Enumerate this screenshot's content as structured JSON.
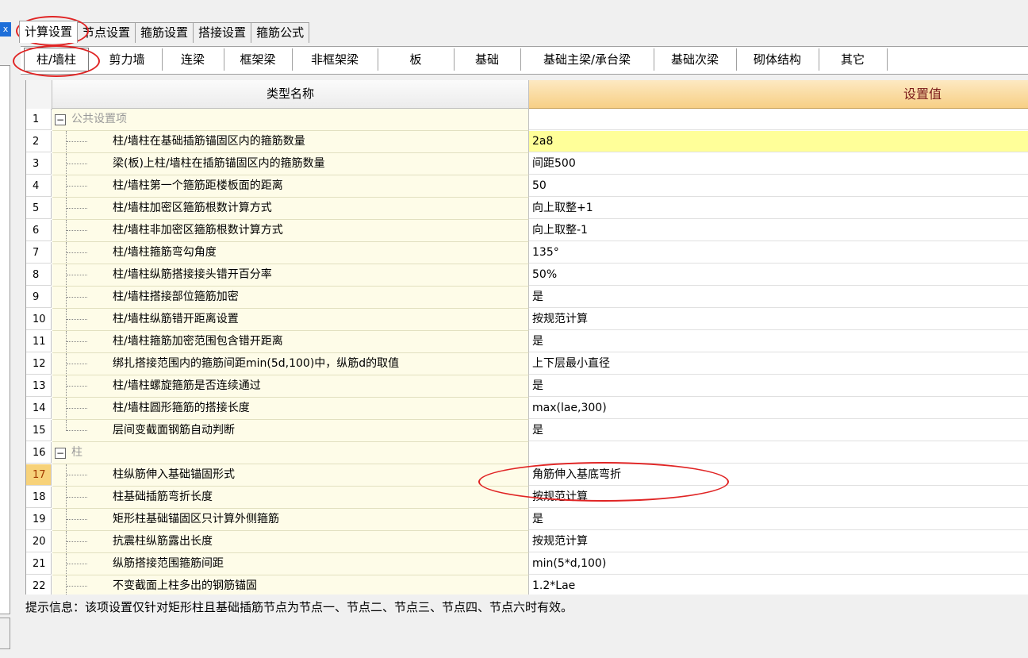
{
  "close_glyph": "x",
  "main_tabs": [
    {
      "label": "计算设置",
      "active": true
    },
    {
      "label": "节点设置",
      "active": false
    },
    {
      "label": "箍筋设置",
      "active": false
    },
    {
      "label": "搭接设置",
      "active": false
    },
    {
      "label": "箍筋公式",
      "active": false
    }
  ],
  "sub_tabs": [
    {
      "label": "柱/墙柱",
      "active": true
    },
    {
      "label": "剪力墙"
    },
    {
      "label": "连梁"
    },
    {
      "label": "框架梁"
    },
    {
      "label": "非框架梁"
    },
    {
      "label": "板"
    },
    {
      "label": "基础"
    },
    {
      "label": "基础主梁/承台梁"
    },
    {
      "label": "基础次梁"
    },
    {
      "label": "砌体结构"
    },
    {
      "label": "其它"
    }
  ],
  "grid": {
    "header_name": "类型名称",
    "header_value": "设置值",
    "rows": [
      {
        "num": "1",
        "type": "group",
        "label": "公共设置项",
        "value": ""
      },
      {
        "num": "2",
        "type": "item",
        "label": "柱/墙柱在基础插筋锚固区内的箍筋数量",
        "value": "2a8",
        "highlight": true
      },
      {
        "num": "3",
        "type": "item",
        "label": "梁(板)上柱/墙柱在插筋锚固区内的箍筋数量",
        "value": "间距500"
      },
      {
        "num": "4",
        "type": "item",
        "label": "柱/墙柱第一个箍筋距楼板面的距离",
        "value": "50"
      },
      {
        "num": "5",
        "type": "item",
        "label": "柱/墙柱加密区箍筋根数计算方式",
        "value": "向上取整+1"
      },
      {
        "num": "6",
        "type": "item",
        "label": "柱/墙柱非加密区箍筋根数计算方式",
        "value": "向上取整-1"
      },
      {
        "num": "7",
        "type": "item",
        "label": "柱/墙柱箍筋弯勾角度",
        "value": "135°"
      },
      {
        "num": "8",
        "type": "item",
        "label": "柱/墙柱纵筋搭接接头错开百分率",
        "value": "50%"
      },
      {
        "num": "9",
        "type": "item",
        "label": "柱/墙柱搭接部位箍筋加密",
        "value": "是"
      },
      {
        "num": "10",
        "type": "item",
        "label": "柱/墙柱纵筋错开距离设置",
        "value": "按规范计算"
      },
      {
        "num": "11",
        "type": "item",
        "label": "柱/墙柱箍筋加密范围包含错开距离",
        "value": "是"
      },
      {
        "num": "12",
        "type": "item",
        "label": "绑扎搭接范围内的箍筋间距min(5d,100)中，纵筋d的取值",
        "value": "上下层最小直径"
      },
      {
        "num": "13",
        "type": "item",
        "label": "柱/墙柱螺旋箍筋是否连续通过",
        "value": "是"
      },
      {
        "num": "14",
        "type": "item",
        "label": "柱/墙柱圆形箍筋的搭接长度",
        "value": "max(lae,300)"
      },
      {
        "num": "15",
        "type": "item",
        "label": "层间变截面钢筋自动判断",
        "value": "是",
        "last": true
      },
      {
        "num": "16",
        "type": "group",
        "label": "柱",
        "value": ""
      },
      {
        "num": "17",
        "type": "item",
        "label": "柱纵筋伸入基础锚固形式",
        "value": "角筋伸入基底弯折",
        "selected": true
      },
      {
        "num": "18",
        "type": "item",
        "label": "柱基础插筋弯折长度",
        "value": "按规范计算"
      },
      {
        "num": "19",
        "type": "item",
        "label": "矩形柱基础锚固区只计算外侧箍筋",
        "value": "是"
      },
      {
        "num": "20",
        "type": "item",
        "label": "抗震柱纵筋露出长度",
        "value": "按规范计算"
      },
      {
        "num": "21",
        "type": "item",
        "label": "纵筋搭接范围箍筋间距",
        "value": "min(5*d,100)"
      },
      {
        "num": "22",
        "type": "item",
        "label": "不变截面上柱多出的钢筋锚固",
        "value": "1.2*Lae"
      }
    ]
  },
  "hint": "提示信息：该项设置仅针对矩形柱且基础插筋节点为节点一、节点二、节点三、节点四、节点六时有效。"
}
